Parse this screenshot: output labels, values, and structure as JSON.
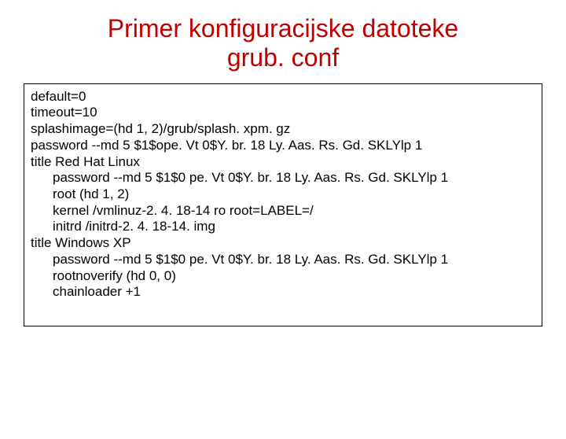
{
  "title_line1": "Primer konfiguracijske datoteke",
  "title_line2": "grub. conf",
  "config": {
    "l0": "default=0",
    "l1": "timeout=10",
    "l2": "splashimage=(hd 1, 2)/grub/splash. xpm. gz",
    "l3": "password --md 5 $1$ope. Vt 0$Y. br. 18 Ly. Aas. Rs. Gd. SKLYlp 1",
    "l4": "title Red Hat Linux",
    "l5": "password --md 5 $1$0 pe. Vt 0$Y. br. 18 Ly. Aas. Rs. Gd. SKLYlp 1",
    "l6": "root (hd 1, 2)",
    "l7": "kernel /vmlinuz-2. 4. 18-14 ro root=LABEL=/",
    "l8": "initrd /initrd-2. 4. 18-14. img",
    "l9": "title Windows XP",
    "l10": "password --md 5 $1$0 pe. Vt 0$Y. br. 18 Ly. Aas. Rs. Gd. SKLYlp 1",
    "l11": "rootnoverify (hd 0, 0)",
    "l12": "chainloader +1"
  }
}
